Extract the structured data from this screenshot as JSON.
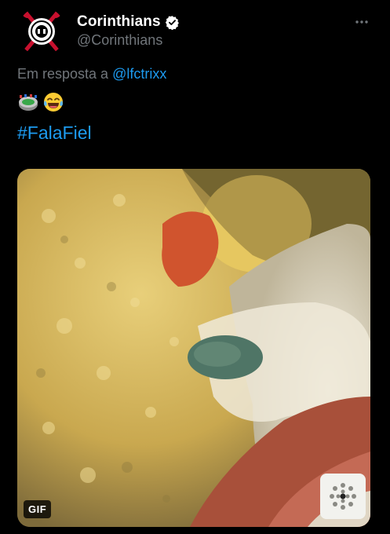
{
  "tweet": {
    "author": {
      "display_name": "Corinthians",
      "handle": "@Corinthians",
      "verified": true
    },
    "reply_prefix": "Em resposta a",
    "reply_to": "@lfctrixx",
    "emojis": [
      "stadium-emoji",
      "tears-of-joy-emoji"
    ],
    "hashtag": "#FalaFiel",
    "media": {
      "type": "GIF",
      "badge": "GIF"
    }
  },
  "colors": {
    "background": "#000000",
    "text_primary": "#ffffff",
    "text_secondary": "#71767b",
    "link": "#1d9bf0"
  }
}
